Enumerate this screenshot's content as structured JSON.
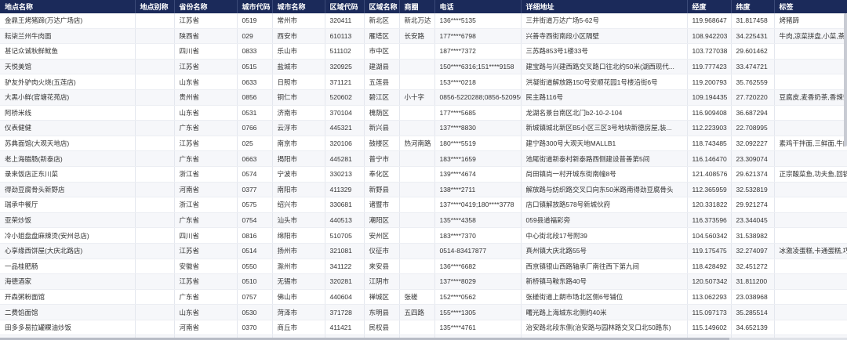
{
  "columns": [
    "地点名称",
    "地点别称",
    "省份名称",
    "城市代码",
    "城市名称",
    "区域代码",
    "区域名称",
    "商圈",
    "电话",
    "详细地址",
    "经度",
    "纬度",
    "标签"
  ],
  "rows": [
    [
      "金鼎王烤猪蹄(万达广场店)",
      "",
      "江苏省",
      "0519",
      "常州市",
      "320411",
      "新北区",
      "新北万达",
      "136****5135",
      "三井街道万达广场5-62号",
      "119.968647",
      "31.817458",
      "烤猪蹄"
    ],
    [
      "耘柒兰州牛肉面",
      "",
      "陕西省",
      "029",
      "西安市",
      "610113",
      "雁塔区",
      "长安路",
      "177****6798",
      "兴善寺西街南段小区隔壁",
      "108.942203",
      "34.225431",
      "牛肉,凉菜拼盘,小菜,茶叶蛋,炸"
    ],
    [
      "甚记众诚秋鲜鱿鱼",
      "",
      "四川省",
      "0833",
      "乐山市",
      "511102",
      "市中区",
      "",
      "187****7372",
      "三苏路853号1楼33号",
      "103.727038",
      "29.601462",
      ""
    ],
    [
      "天悦美馆",
      "",
      "江苏省",
      "0515",
      "盐城市",
      "320925",
      "建湖县",
      "",
      "150****6316;151****9158",
      "建宝路与兴建西路交叉路口往北约50米(湖西现代...",
      "119.777423",
      "33.474721",
      ""
    ],
    [
      "驴友外驴肉火烧(五莲店)",
      "",
      "山东省",
      "0633",
      "日照市",
      "371121",
      "五莲县",
      "",
      "153****0218",
      "洪凝街道解放路150号安顺花园1号楼沿街6号",
      "119.200793",
      "35.762559",
      ""
    ],
    [
      "大黑小鲜(官塘花苑店)",
      "",
      "贵州省",
      "0856",
      "铜仁市",
      "520602",
      "碧江区",
      "小十字",
      "0856-5220288;0856-5209566",
      "民主路116号",
      "109.194435",
      "27.720220",
      "豆腐皮,麦香奶茶,香辣笋干板"
    ],
    [
      "阿桥米线",
      "",
      "山东省",
      "0531",
      "济南市",
      "370104",
      "槐荫区",
      "",
      "177****5685",
      "龙湖名景台南区北门b2-10-2-104",
      "116.909408",
      "36.687294",
      ""
    ],
    [
      "仪表健健",
      "",
      "广东省",
      "0766",
      "云浮市",
      "445321",
      "新兴县",
      "",
      "137****8830",
      "新城镇城北新区B5小区三区3号地块新德房屋,装...",
      "112.223903",
      "22.708995",
      ""
    ],
    [
      "苏典面馆(大观天地店)",
      "",
      "江苏省",
      "025",
      "南京市",
      "320106",
      "鼓楼区",
      "热河南路",
      "180****5519",
      "建宁路300号大观天地MALLB1",
      "118.743485",
      "32.092227",
      "素鸡干拌面,三鲜面,牛肉炒饭"
    ],
    [
      "老上海腊肠(新泰店)",
      "",
      "广东省",
      "0663",
      "揭阳市",
      "445281",
      "普宁市",
      "",
      "183****1659",
      "池尾街道新泰村新泰路西侧建设普善第5间",
      "116.146470",
      "23.309074",
      ""
    ],
    [
      "录来饭店正东川菜",
      "",
      "浙江省",
      "0574",
      "宁波市",
      "330213",
      "奉化区",
      "",
      "139****4674",
      "尚田镇尚一村开城东街南幢8号",
      "121.408576",
      "29.621374",
      "正宗酸菜鱼,功夫鱼,回锅肉炒饭"
    ],
    [
      "得劲豆腐骨头新野店",
      "",
      "河南省",
      "0377",
      "南阳市",
      "411329",
      "新野县",
      "",
      "138****2711",
      "解放路与纺织路交叉口向东50米路南得劲豆腐骨头",
      "112.365959",
      "32.532819",
      ""
    ],
    [
      "瑞承中餐厅",
      "",
      "浙江省",
      "0575",
      "绍兴市",
      "330681",
      "诸暨市",
      "",
      "137****0419;180****3778",
      "店口镇解放路578号新城伙府",
      "120.331822",
      "29.921274",
      ""
    ],
    [
      "亚荣炒饭",
      "",
      "广东省",
      "0754",
      "汕头市",
      "440513",
      "潮阳区",
      "",
      "135****4358",
      "059县道福彩旁",
      "116.373596",
      "23.344045",
      ""
    ],
    [
      "冷小姐盘盘麻辣烫(安州总店)",
      "",
      "四川省",
      "0816",
      "绵阳市",
      "510705",
      "安州区",
      "",
      "183****7370",
      "中心街北段17号附39",
      "104.560342",
      "31.538982",
      ""
    ],
    [
      "心享缘西饼屋(大庆北路店)",
      "",
      "江苏省",
      "0514",
      "扬州市",
      "321081",
      "仪征市",
      "",
      "0514-83417877",
      "真州镇大庆北路55号",
      "119.175475",
      "32.274097",
      "冰激凌蛋糕,卡通蛋糕,巧克力蛋"
    ],
    [
      "一品桂肥肠",
      "",
      "安徽省",
      "0550",
      "滁州市",
      "341122",
      "来安县",
      "",
      "136****6682",
      "西京镇银山西路轴承厂南往西下第九间",
      "118.428492",
      "32.451272",
      ""
    ],
    [
      "海德酒家",
      "",
      "江苏省",
      "0510",
      "无锡市",
      "320281",
      "江阴市",
      "",
      "137****8029",
      "新桥镇马鞍东路40号",
      "120.507342",
      "31.811200",
      ""
    ],
    [
      "开森粥粉面馆",
      "",
      "广东省",
      "0757",
      "佛山市",
      "440604",
      "禅城区",
      "张槎",
      "152****0562",
      "张槎街道上朗市场北区侧6号铺位",
      "113.062293",
      "23.038968",
      ""
    ],
    [
      "二费馅面馆",
      "",
      "山东省",
      "0530",
      "菏泽市",
      "371728",
      "东明县",
      "五四路",
      "155****1305",
      "曙光路上海城东北侧约40米",
      "115.097173",
      "35.285514",
      ""
    ],
    [
      "田多多易拉罐粿油炒饭",
      "",
      "河南省",
      "0370",
      "商丘市",
      "411421",
      "民权县",
      "",
      "135****4761",
      "治安路北段东侧(治安路与园林路交叉口北50路东)",
      "115.149602",
      "34.652139",
      ""
    ],
    [
      "湖市牛肉粉馆",
      "",
      "湖北省",
      "027",
      "武汉市",
      "420102",
      "江岸区",
      "二七",
      "139****6326",
      "后湖街道兴业南路9号",
      "114.302345",
      "30.638384",
      "卤鸡蛋,酸辣鸡杂粉,红烧鱼块,肥"
    ]
  ]
}
